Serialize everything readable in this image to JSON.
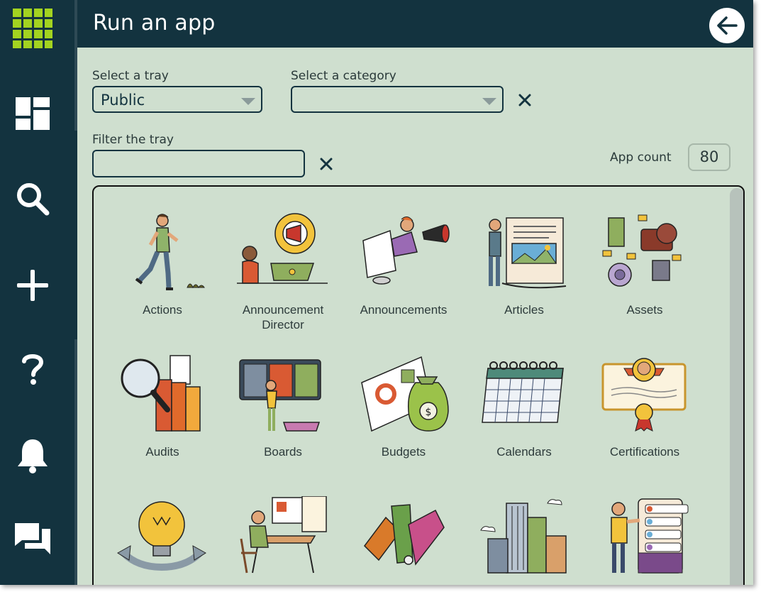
{
  "header": {
    "title": "Run an app"
  },
  "sidebar": {
    "items": [
      {
        "icon": "apps-grid-icon"
      },
      {
        "icon": "dashboard-icon"
      },
      {
        "icon": "search-icon"
      },
      {
        "icon": "plus-icon"
      },
      {
        "icon": "help-icon"
      },
      {
        "icon": "bell-icon"
      },
      {
        "icon": "chat-icon"
      }
    ],
    "accent_color": "#a3d320"
  },
  "filters": {
    "tray_label": "Select a tray",
    "tray_value": "Public",
    "category_label": "Select a category",
    "category_value": "",
    "filter_label": "Filter the tray",
    "filter_value": "",
    "app_count_label": "App count",
    "app_count": "80"
  },
  "apps": [
    {
      "name": "Actions"
    },
    {
      "name": "Announcement Director"
    },
    {
      "name": "Announcements"
    },
    {
      "name": "Articles"
    },
    {
      "name": "Assets"
    },
    {
      "name": "Audits"
    },
    {
      "name": "Boards"
    },
    {
      "name": "Budgets"
    },
    {
      "name": "Calendars"
    },
    {
      "name": "Certifications"
    },
    {
      "name": ""
    },
    {
      "name": ""
    },
    {
      "name": ""
    },
    {
      "name": ""
    },
    {
      "name": ""
    }
  ],
  "colors": {
    "nav_bg": "#13333f",
    "content_bg": "#cfdfcf"
  }
}
